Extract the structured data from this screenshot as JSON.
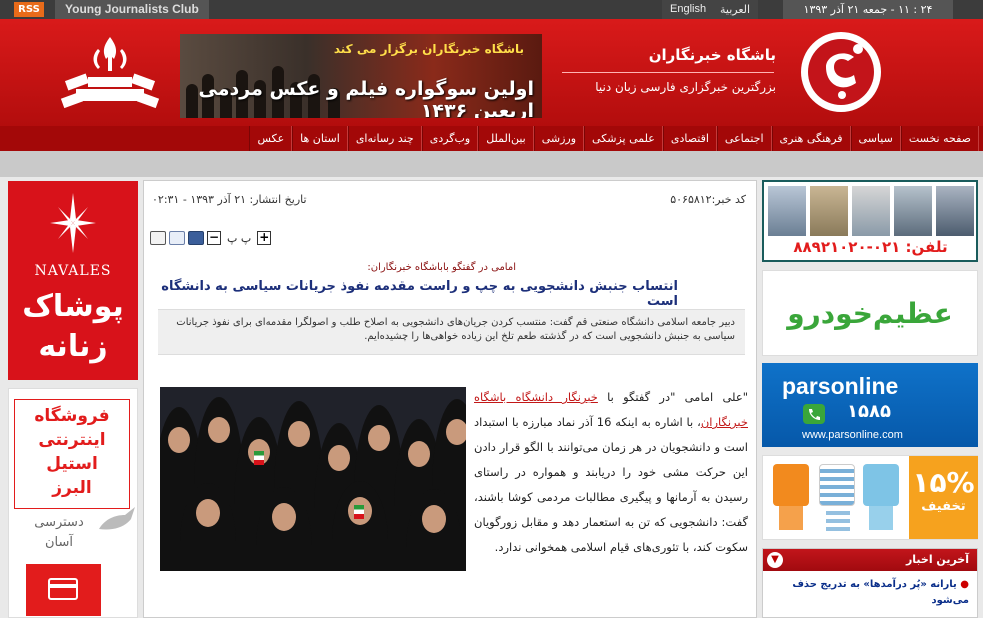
{
  "topbar": {
    "rss_label": "RSS",
    "site_name_en": "Young Journalists Club",
    "lang_en": "English",
    "lang_ar": "العربية",
    "datetime": "۲۴ : ۱۱ - جمعه ۲۱ آذر ۱۳۹۳"
  },
  "header": {
    "banner_line1": "باشگاه خبرنگاران برگزار می کند",
    "banner_line2": "اولین سوگواره فیلم و عکس مردمی اربعین ۱۴۳۶",
    "brand_title": "باشگاه خبرنگاران",
    "brand_subtitle": "بزرگترین خبرگزاری فارسی زبان دنیا"
  },
  "nav": {
    "items": [
      "صفحه نخست",
      "سیاسی",
      "فرهنگی هنری",
      "اجتماعی",
      "اقتصادی",
      "علمی پزشکی",
      "ورزشی",
      "بین‌الملل",
      "وب‌گردی",
      "چند رسانه‌ای",
      "استان ها",
      "عکس"
    ]
  },
  "article": {
    "news_code": "کد خبر:۵۰۶۵۸۱۲",
    "publish_date": "تاریخ انتشار: ۲۱ آذر ۱۳۹۳ - ۰۲:۳۱",
    "font_size_label": "پ پ",
    "kicker": "امامی در گفتگو باباشگاه خبرنگاران:",
    "headline": "انتساب جنبش دانشجویی به چپ و راست مقدمه نفوذ جریانات سیاسی به دانشگاه است",
    "lead": "دبیر جامعه اسلامی دانشگاه صنعتی قم گفت: منتسب کردن جریان‌های دانشجویی به اصلاح طلب و اصولگرا مقدمه‌ای برای نفوذ جریانات سیاسی به جنبش دانشجویی است که در گذشته طعم تلخ این زیاده خواهی‌ها را چشیده‌ایم.",
    "body_before_link": "\"علی امامی \"در گفتگو با ",
    "body_link": "خبرنگار دانشگاه باشگاه خبرنگاران",
    "body_after_link": "، با اشاره به اینکه 16 آذر نماد مبارزه با استبداد است و دانشجویان در هر زمان می‌توانند با الگو قرار دادن این حرکت مشی خود را دریابند و همواره در راستای رسیدن به آرمانها و پیگیری مطالبات مردمی کوشا باشند، گفت: دانشجویی که تن به استعمار دهد و مقابل زورگویان سکوت کند، با تئوری‌های قیام اسلامی همخوانی ندارد."
  },
  "left_ads": {
    "navales_name": "NAVALES",
    "navales_fa1": "پوشاک",
    "navales_fa2": "زنانه",
    "shop_line1": "فروشگاه",
    "shop_line2": "اینترنتی",
    "shop_line3": "استیل",
    "shop_line4": "البرز",
    "shop_sub1": "دسترسی",
    "shop_sub2": "آسان"
  },
  "right_ads": {
    "clean_phone": "تلفن: ۰۲۱-۸۸۹۲۱۰۲۰",
    "azim_text": "عظیم‌خودرو",
    "pars_brand": "parsonline",
    "pars_number": "۱۵۸۵",
    "pars_url": "www.parsonline.com",
    "kids_percent": "۱۵%",
    "kids_discount": "تخفیف"
  },
  "latest_news": {
    "title": "آخرین اخبار",
    "item1": "یارانه «پُر درآمدها» به تدریج حذف می‌شود"
  },
  "colors": {
    "brand_red": "#d91a1a",
    "nav_red": "#a30808",
    "headline_blue": "#1c2f7a"
  }
}
